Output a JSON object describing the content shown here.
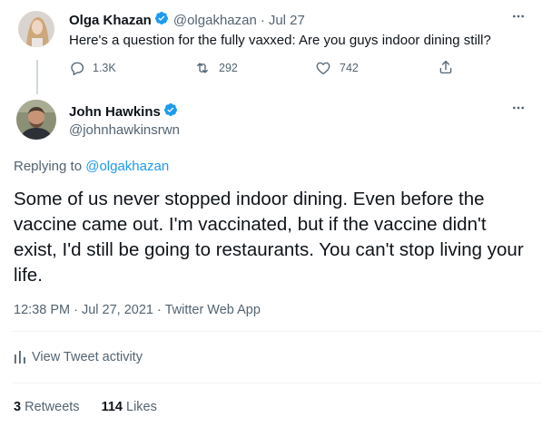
{
  "original_tweet": {
    "display_name": "Olga Khazan",
    "handle": "@olgakhazan",
    "separator": "·",
    "date": "Jul 27",
    "text": "Here's a question for the fully vaxxed: Are you guys indoor dining still?",
    "replies_count": "1.3K",
    "retweets_count": "292",
    "likes_count": "742",
    "more_icon": "more-horizontal-icon"
  },
  "reply_tweet": {
    "display_name": "John Hawkins",
    "handle": "@johnhawkinsrwn",
    "replying_to_prefix": "Replying to",
    "replying_to_handle": "@olgakhazan",
    "text": "Some of us never stopped indoor dining. Even before the vaccine came out. I'm vaccinated, but if the vaccine didn't exist, I'd still be going to restaurants. You can't stop living your life.",
    "timestamp": "12:38 PM · Jul 27, 2021 · Twitter Web App",
    "view_activity_label": "View Tweet activity",
    "retweets_count": "3",
    "retweets_label": "Retweets",
    "likes_count": "114",
    "likes_label": "Likes"
  },
  "colors": {
    "accent": "#1d9bf0",
    "text_primary": "#0f1419",
    "text_secondary": "#536471",
    "divider": "#eff3f4"
  }
}
